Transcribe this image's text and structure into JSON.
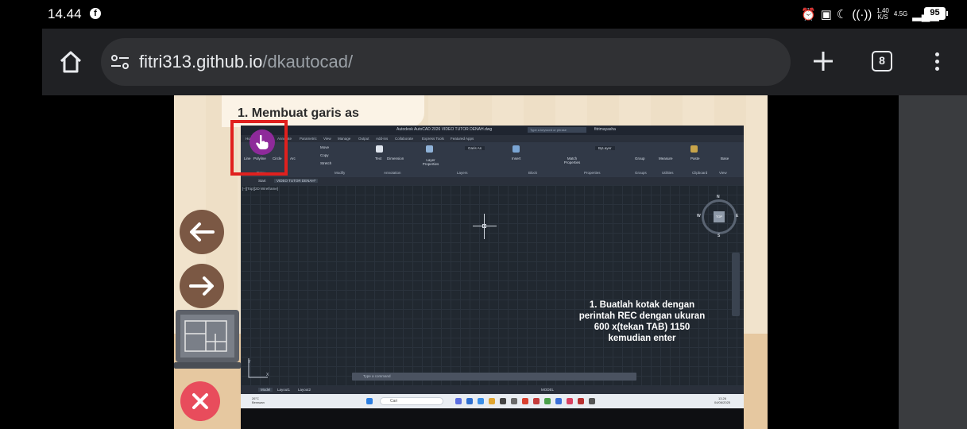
{
  "status_bar": {
    "time": "14.44",
    "speed_value": "1,40",
    "speed_unit": "K/S",
    "network": "4.5G",
    "battery": "95"
  },
  "browser": {
    "url_domain": "fitri313.github.io",
    "url_path": "/dkautocad/",
    "tab_count": "8"
  },
  "slide": {
    "title": "1. Membuat garis as",
    "instruction": "1. Buatlah kotak dengan perintah REC dengan ukuran 600 x(tekan TAB) 1150 kemudian enter"
  },
  "autocad": {
    "window_title": "Autodesk AutoCAD 2026    VIDEO TUTOR DENAH.dwg",
    "search_placeholder": "Type a keyword or phrase",
    "user": "fitrimayasha",
    "ribbon_tabs": [
      "Home",
      "Insert",
      "Annotate",
      "Parametric",
      "View",
      "Manage",
      "Output",
      "Add-ins",
      "Collaborate",
      "Express Tools",
      "Featured Apps"
    ],
    "panel_labels": [
      "Draw",
      "Modify",
      "Annotation",
      "Layers",
      "Block",
      "Properties",
      "Groups",
      "Utilities",
      "Clipboard",
      "View"
    ],
    "tool_labels": {
      "line": "Line",
      "polyline": "Polyline",
      "circle": "Circle",
      "arc": "Arc",
      "move": "Move",
      "copy": "Copy",
      "stretch": "Stretch",
      "text": "Text",
      "dimension": "Dimension",
      "layer_properties": "Layer Properties",
      "layer_name": "Garis As",
      "insert": "Insert",
      "match_properties": "Match Properties",
      "bylayer": "ByLayer",
      "group": "Group",
      "measure": "Measure",
      "paste": "Paste",
      "base": "Base"
    },
    "file_tabs": [
      "Start",
      "VIDEO TUTOR DENAH*"
    ],
    "viewport_label": "[–][Top][2D Wireframe]",
    "viewcube": {
      "n": "N",
      "s": "S",
      "e": "E",
      "w": "W",
      "top": "TOP"
    },
    "command_placeholder": "Type a command",
    "layout_tabs": [
      "Model",
      "Layout1",
      "Layout2"
    ],
    "status_model": "MODEL"
  },
  "taskbar": {
    "weather_temp": "26°C",
    "weather_desc": "Berawan",
    "search_label": "Cari",
    "time": "13.26",
    "date": "04/06/2025"
  },
  "colors": {
    "accent_red": "#e0201e",
    "nav_brown": "#7b5844",
    "close_red": "#e84c5c",
    "cursor_purple": "#8e2a9a"
  },
  "icons": {
    "prev": "arrow-left-icon",
    "next": "arrow-right-icon",
    "close": "close-icon",
    "home": "home-icon",
    "tabs": "tab-switcher-icon",
    "menu": "more-vert-icon"
  }
}
